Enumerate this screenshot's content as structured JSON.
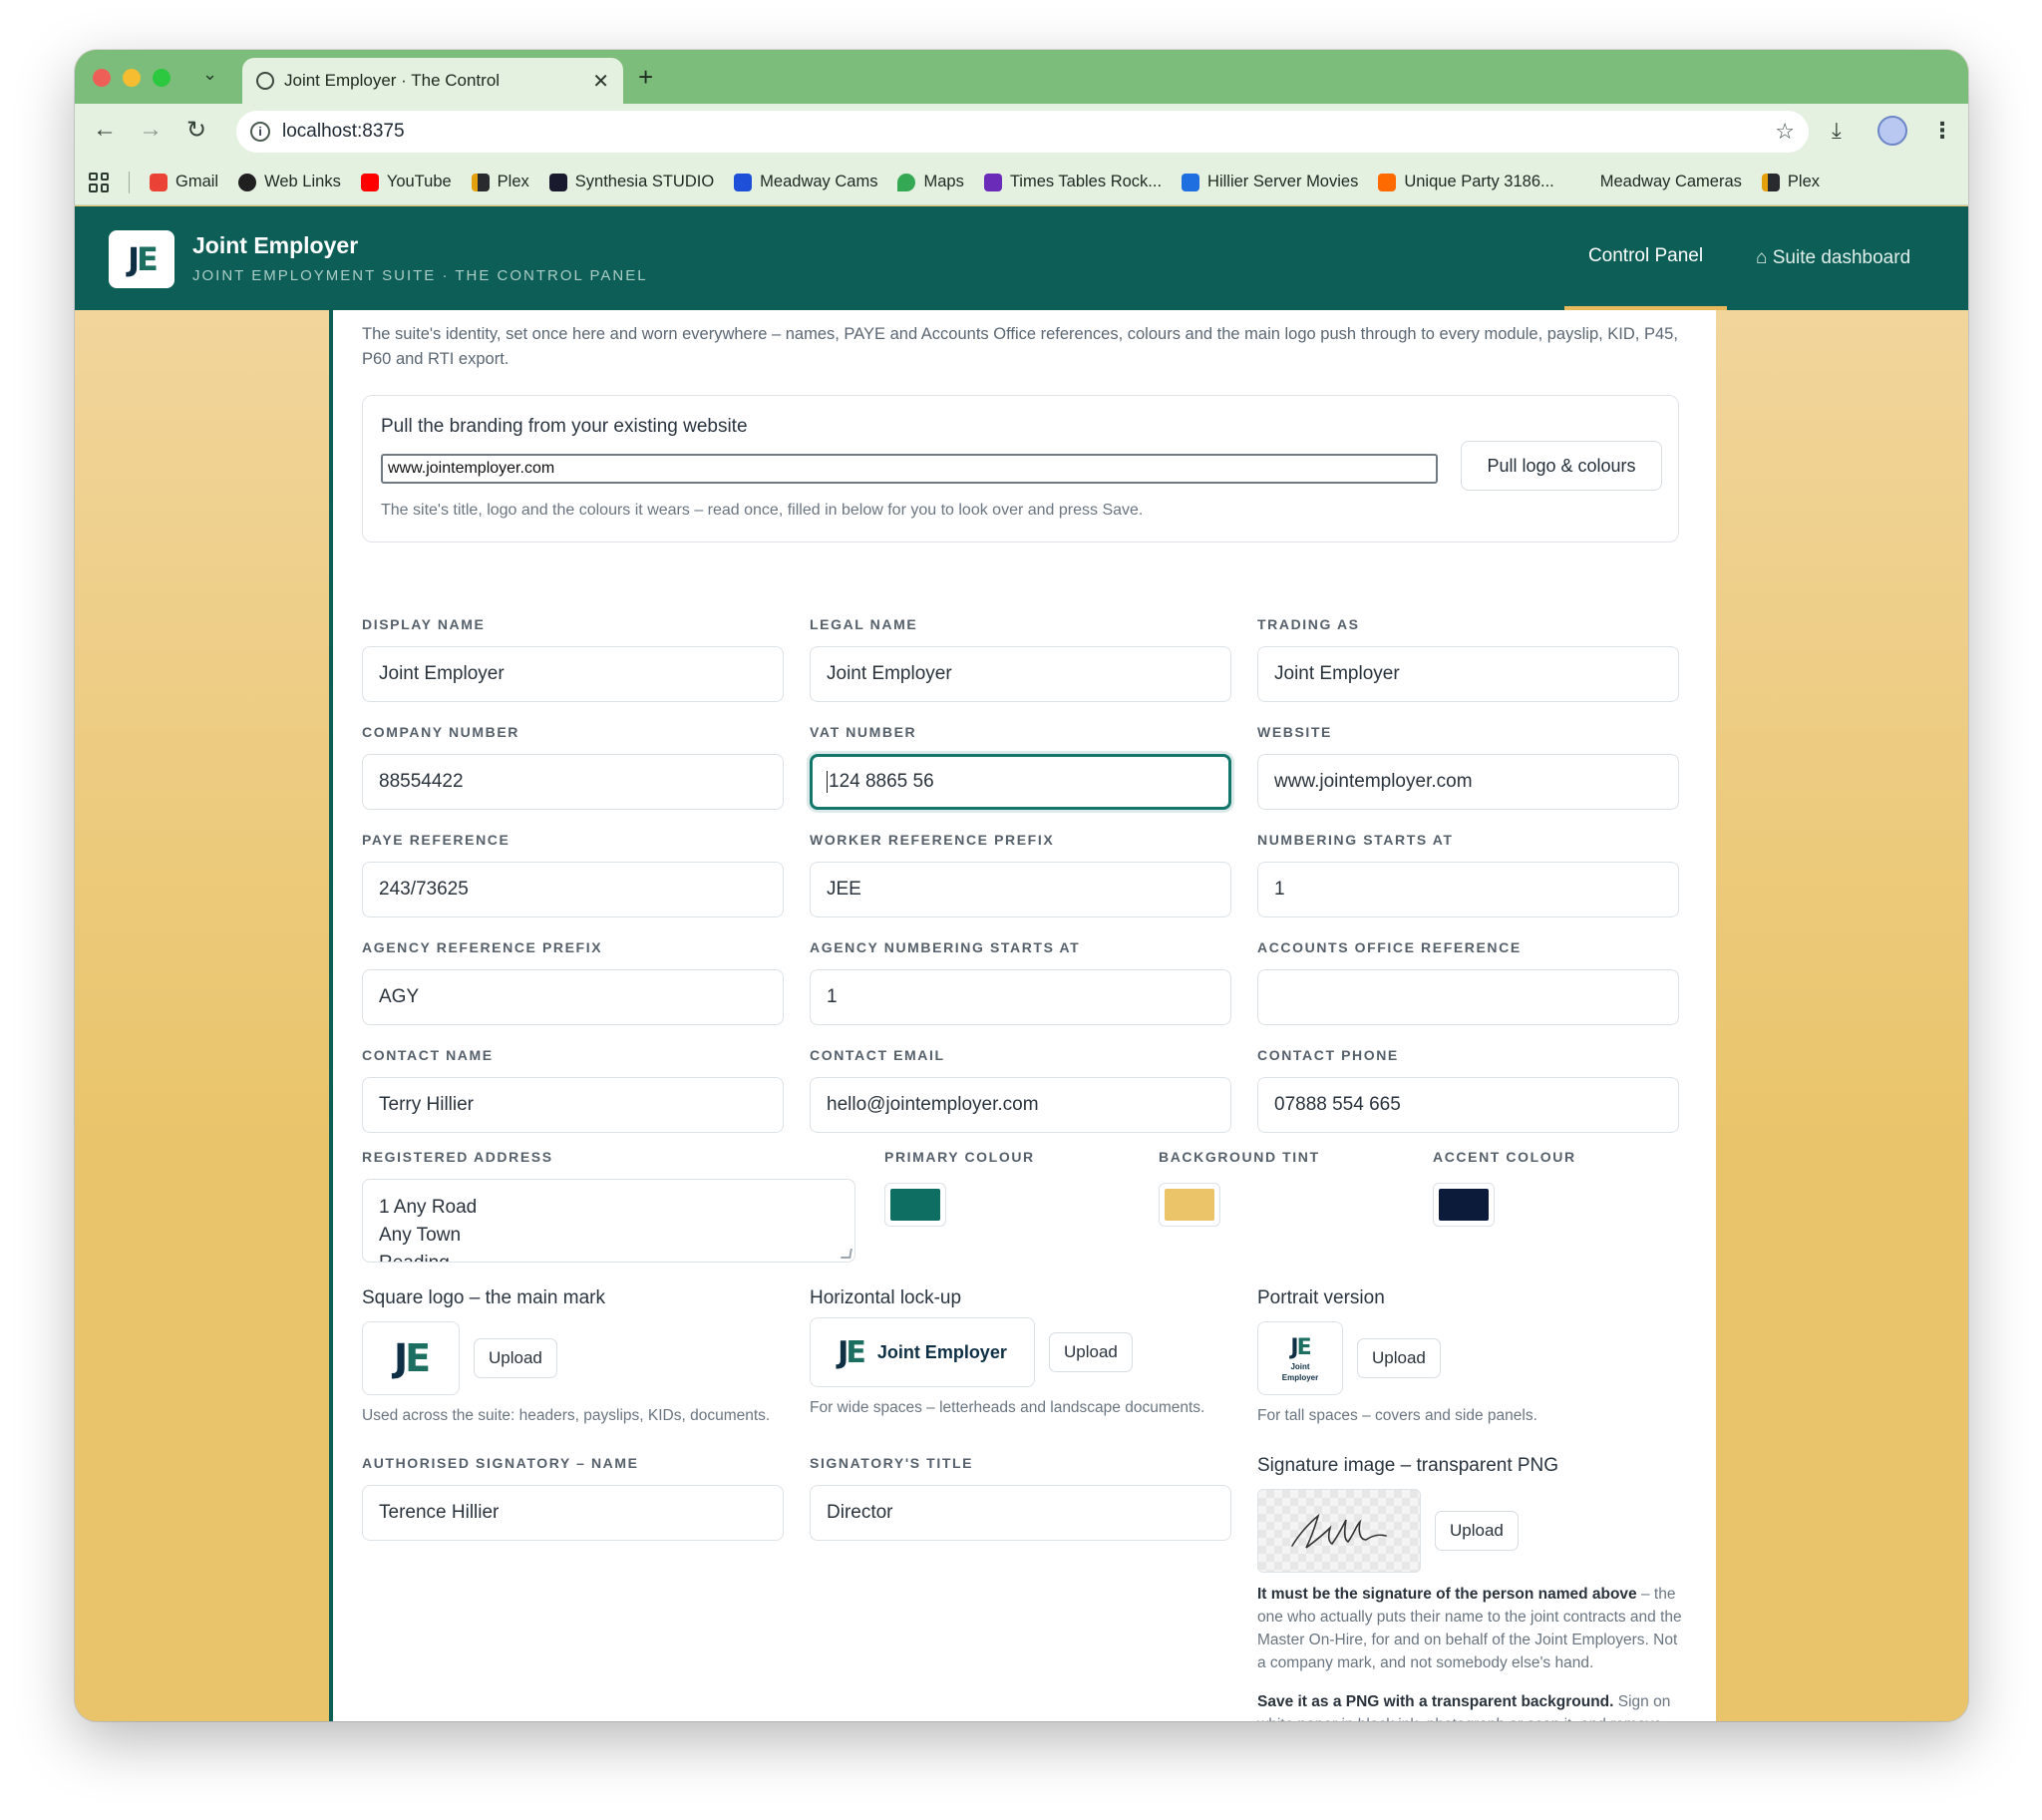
{
  "browser": {
    "tab_title": "Joint Employer · The Control",
    "new_tab": "+",
    "url": "localhost:8375",
    "bookmarks": [
      "Gmail",
      "Web Links",
      "YouTube",
      "Plex",
      "Synthesia STUDIO",
      "Meadway Cams",
      "Maps",
      "Times Tables Rock...",
      "Hillier Server Movies",
      "Unique Party 3186...",
      "Meadway Cameras",
      "Plex"
    ]
  },
  "header": {
    "logo_j": "J",
    "logo_e": "E",
    "app_name": "Joint Employer",
    "subtitle": "JOINT EMPLOYMENT SUITE · THE CONTROL PANEL",
    "nav_control_panel": "Control Panel",
    "nav_suite_dashboard": "⌂ Suite dashboard"
  },
  "intro": "The suite's identity, set once here and worn everywhere – names, PAYE and Accounts Office references, colours and the main logo push through to every module, payslip, KID, P45, P60 and RTI export.",
  "pull": {
    "title": "Pull the branding from your existing website",
    "url_value": "www.jointemployer.com",
    "button": "Pull logo & colours",
    "note": "The site's title, logo and the colours it wears – read once, filled in below for you to look over and press Save."
  },
  "fields": {
    "display_name": {
      "label": "Display name",
      "value": "Joint Employer"
    },
    "legal_name": {
      "label": "Legal name",
      "value": "Joint Employer"
    },
    "trading_as": {
      "label": "Trading as",
      "value": "Joint Employer"
    },
    "company_number": {
      "label": "Company number",
      "value": "88554422"
    },
    "vat_number": {
      "label": "VAT number",
      "value": "124 8865 56"
    },
    "website": {
      "label": "Website",
      "value": "www.jointemployer.com"
    },
    "paye_reference": {
      "label": "PAYE reference",
      "value": "243/73625"
    },
    "worker_prefix": {
      "label": "Worker reference prefix",
      "value": "JEE"
    },
    "numbering_starts": {
      "label": "Numbering starts at",
      "value": "1"
    },
    "agency_prefix": {
      "label": "Agency reference prefix",
      "value": "AGY"
    },
    "agency_numbering": {
      "label": "Agency numbering starts at",
      "value": "1"
    },
    "accounts_office": {
      "label": "Accounts office reference",
      "value": ""
    },
    "contact_name": {
      "label": "Contact name",
      "value": "Terry Hillier"
    },
    "contact_email": {
      "label": "Contact email",
      "value": "hello@jointemployer.com"
    },
    "contact_phone": {
      "label": "Contact phone",
      "value": "07888 554 665"
    },
    "registered_address": {
      "label": "Registered address",
      "line1": "1 Any Road",
      "line2": "Any Town",
      "line3": "Reading"
    },
    "signatory_name": {
      "label": "Authorised signatory – name",
      "value": "Terence Hillier"
    },
    "signatory_title": {
      "label": "Signatory's title",
      "value": "Director"
    }
  },
  "colours": {
    "primary_label": "Primary colour",
    "primary": "#0f6e62",
    "background_label": "Background tint",
    "background": "#ebc46a",
    "accent_label": "Accent colour",
    "accent": "#0d1b3a"
  },
  "logos": {
    "square": {
      "title": "Square logo – the main mark",
      "note": "Used across the suite: headers, payslips, KIDs, documents."
    },
    "horizontal": {
      "title": "Horizontal lock-up",
      "wordmark": "Joint Employer",
      "note": "For wide spaces – letterheads and landscape documents."
    },
    "portrait": {
      "title": "Portrait version",
      "wordmark_line1": "Joint",
      "wordmark_line2": "Employer",
      "note": "For tall spaces – covers and side panels."
    },
    "upload_label": "Upload"
  },
  "signature": {
    "title": "Signature image – transparent PNG",
    "para1_bold": "It must be the signature of the person named above",
    "para1_rest": " – the one who actually puts their name to the joint contracts and the Master On-Hire, for and on behalf of the Joint Employers. Not a company mark, and not somebody else's hand.",
    "para2_bold": "Save it as a PNG with a transparent background.",
    "para2_rest": " Sign on white paper in black ink, photograph or scan it, and remove the background before uploading – a JPEG, or a"
  }
}
